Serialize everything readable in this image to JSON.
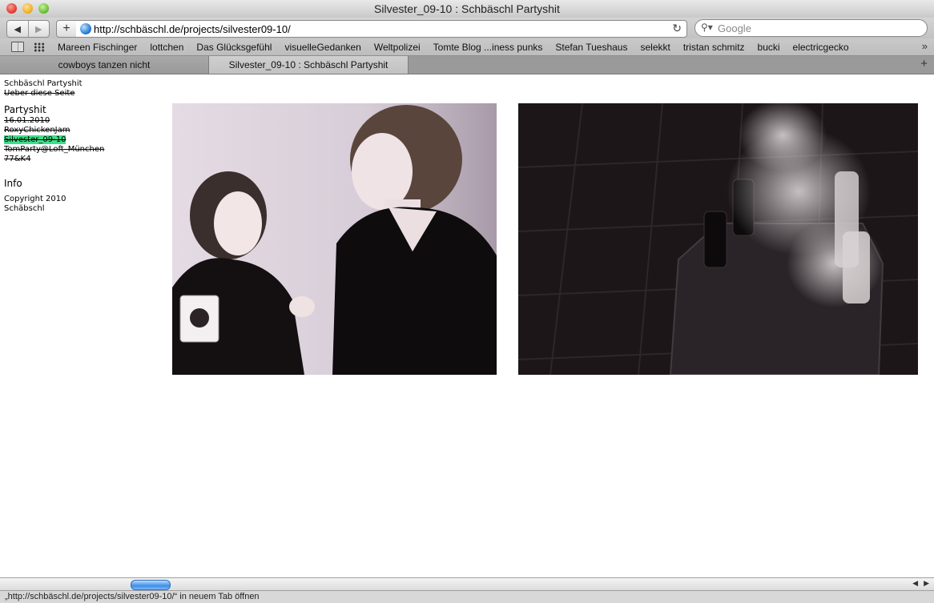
{
  "window": {
    "title": "Silvester_09-10 : Schbäschl Partyshit"
  },
  "toolbar": {
    "back_icon": "back-arrow-icon",
    "forward_icon": "forward-arrow-icon",
    "add_label": "+",
    "url": "http://schbäschl.de/projects/silvester09-10/",
    "search_placeholder": "Google"
  },
  "bookmarks": [
    "Mareen Fischinger",
    "lottchen",
    "Das Glücksgefühl",
    "visuelleGedanken",
    "Weltpolizei",
    "Tomte Blog ...iness punks",
    "Stefan Tueshaus",
    "selekkt",
    "tristan schmitz",
    "bucki",
    "electricgecko"
  ],
  "tabs": [
    {
      "label": "cowboys tanzen nicht",
      "active": false
    },
    {
      "label": "Silvester_09-10 : Schbäschl Partyshit",
      "active": true
    }
  ],
  "sidebar": {
    "site_title": "Schbäschl Partyshit",
    "about_link": "Ueber diese Seite",
    "partyshit_heading": "Partyshit",
    "projects": [
      {
        "label": "16.01.2010",
        "current": false
      },
      {
        "label": "RoxyChickenJam",
        "current": false
      },
      {
        "label": "Silvester_09-10",
        "current": true
      },
      {
        "label": "TomParty@Loft_München",
        "current": false
      },
      {
        "label": "77&K4",
        "current": false
      }
    ],
    "info_heading": "Info",
    "copyright_line1": "Copyright 2010",
    "copyright_line2": "Schäbschl"
  },
  "status": {
    "text": "„http://schbäschl.de/projects/silvester09-10/“ in neuem Tab öffnen"
  },
  "colors": {
    "highlight": "#3ee08a"
  }
}
